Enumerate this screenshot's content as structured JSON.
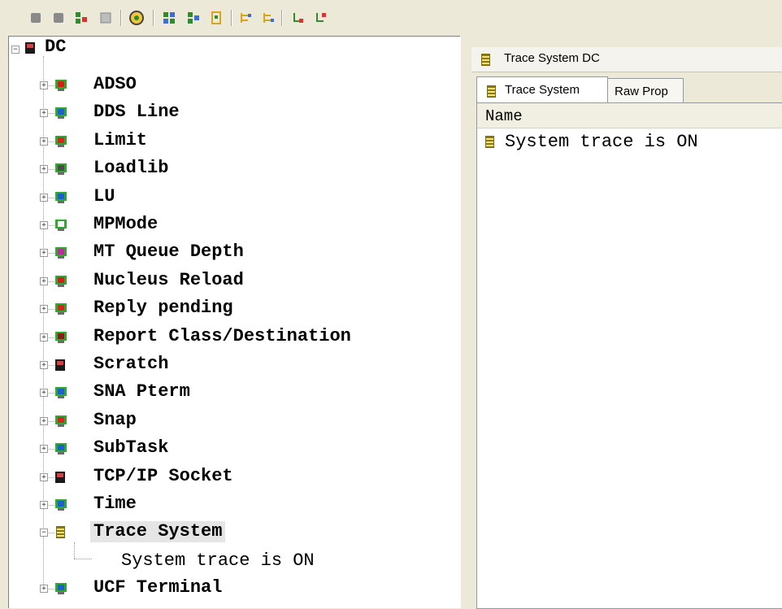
{
  "toolbar": {
    "buttons": [
      {
        "icon": "stop-icon"
      },
      {
        "icon": "stop-icon"
      },
      {
        "icon": "connect-icon"
      },
      {
        "icon": "disconnect-icon"
      },
      {
        "icon": "refresh-icon"
      },
      {
        "icon": "view-icon"
      },
      {
        "icon": "view-icon"
      },
      {
        "icon": "view-icon"
      },
      {
        "icon": "tree-icon"
      },
      {
        "icon": "tree-icon"
      },
      {
        "icon": "hierarchy-icon"
      },
      {
        "icon": "hierarchy-icon"
      }
    ]
  },
  "tree": {
    "root": {
      "label": "DC",
      "icon": "system-icon"
    },
    "items": [
      {
        "label": "ADSO",
        "icon": "monitor-red-icon"
      },
      {
        "label": "DDS Line",
        "icon": "monitor-chart-icon"
      },
      {
        "label": "Limit",
        "icon": "monitor-alert-icon"
      },
      {
        "label": "Loadlib",
        "icon": "monitor-icon"
      },
      {
        "label": "LU",
        "icon": "monitor-lu-icon"
      },
      {
        "label": "MPMode",
        "icon": "monitor-mp-icon"
      },
      {
        "label": "MT Queue Depth",
        "icon": "monitor-mt-icon"
      },
      {
        "label": "Nucleus Reload",
        "icon": "monitor-red-icon"
      },
      {
        "label": "Reply pending",
        "icon": "monitor-reply-icon"
      },
      {
        "label": "Report Class/Destination",
        "icon": "monitor-report-icon"
      },
      {
        "label": "Scratch",
        "icon": "system-icon"
      },
      {
        "label": "SNA Pterm",
        "icon": "monitor-sna-icon"
      },
      {
        "label": "Snap",
        "icon": "monitor-snap-icon"
      },
      {
        "label": "SubTask",
        "icon": "monitor-subtask-icon"
      },
      {
        "label": "TCP/IP Socket",
        "icon": "system-icon"
      },
      {
        "label": "Time",
        "icon": "monitor-clock-icon"
      },
      {
        "label": "Trace System",
        "icon": "document-icon"
      },
      {
        "label": "UCF Terminal",
        "icon": "monitor-ucf-icon"
      }
    ],
    "selected_child": {
      "label": "System trace is ON"
    }
  },
  "right": {
    "title": "Trace System  DC",
    "tabs": [
      {
        "label": "Trace System"
      },
      {
        "label": "Raw Prop"
      }
    ],
    "list": {
      "header": "Name",
      "rows": [
        {
          "text": "System trace is ON"
        }
      ]
    }
  },
  "colors": {
    "chrome": "#ece9d8",
    "monitor_green": "#2fa82f",
    "monitor_red": "#d81b1b",
    "document_yellow": "#e8d04b"
  }
}
